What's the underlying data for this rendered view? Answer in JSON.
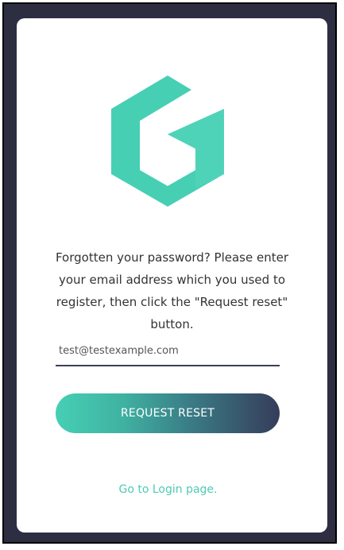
{
  "brand": {
    "logo_icon": "hexagon-g-logo-icon",
    "accent_color": "#47cfb4",
    "dark_color": "#363c5a"
  },
  "reset_form": {
    "instructions": "Forgotten your password? Please enter your email address which you used to register, then click the \"Request reset\" button.",
    "email_value": "test@testexample.com",
    "submit_label": "REQUEST RESET",
    "login_link_label": "Go to Login page."
  }
}
